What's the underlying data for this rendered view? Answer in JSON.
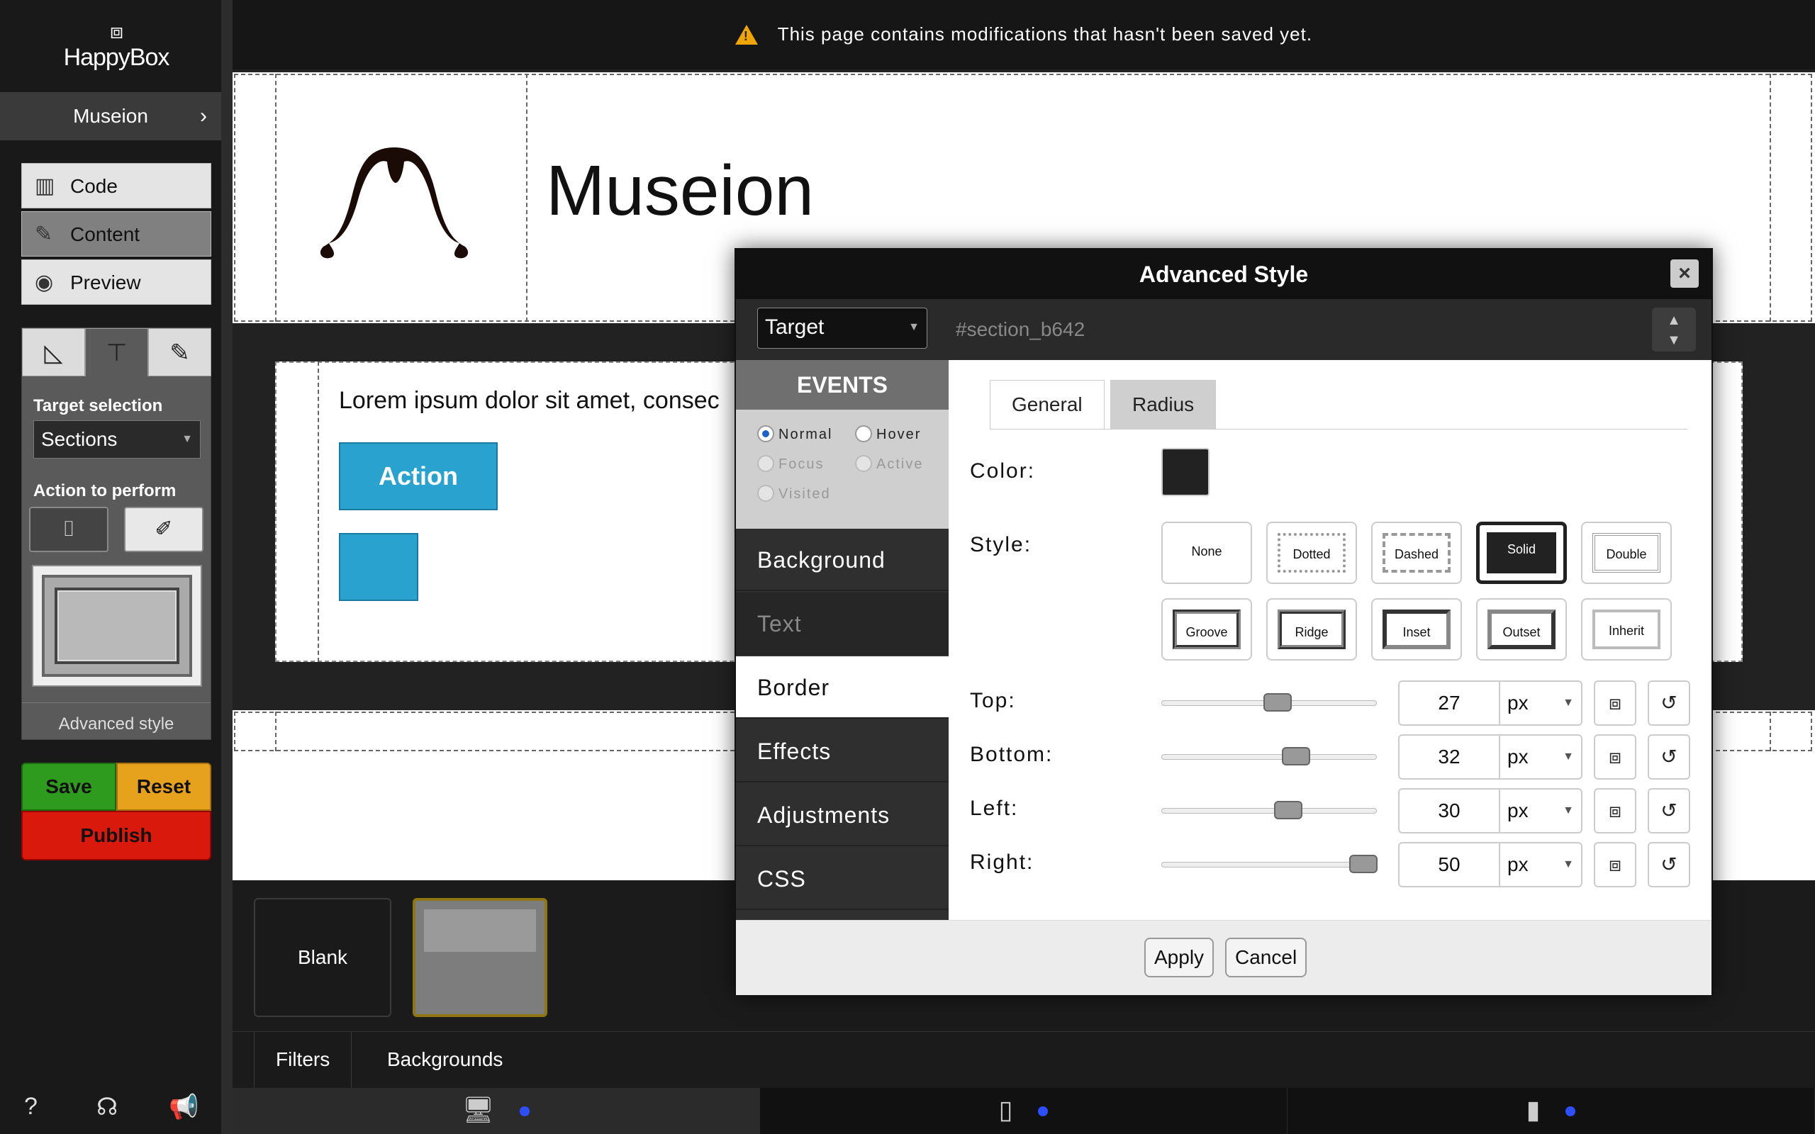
{
  "app": {
    "logo": "HappyBox",
    "site_name": "Museion"
  },
  "sidebar": {
    "modes": [
      {
        "label": "Code",
        "icon": "code-icon"
      },
      {
        "label": "Content",
        "icon": "edit-icon"
      },
      {
        "label": "Preview",
        "icon": "eye-icon"
      }
    ],
    "tool_tabs": [
      "ruler-icon",
      "paint-roller-icon",
      "pencil-icon"
    ],
    "target_selection_label": "Target selection",
    "target_selection_value": "Sections",
    "action_label": "Action to perform",
    "actions": [
      "spray-icon",
      "brush-icon"
    ],
    "advanced_style": "Advanced style",
    "save": "Save",
    "reset": "Reset",
    "publish": "Publish",
    "footer_icons": [
      "help-icon",
      "support-icon",
      "megaphone-icon"
    ]
  },
  "warning": "This page contains modifications that hasn't been saved yet.",
  "canvas": {
    "header_title": "Museion",
    "lorem": "Lorem ipsum dolor sit amet, consec",
    "action_button": "Action"
  },
  "bottom": {
    "tile_blank": "Blank",
    "tabs": [
      "Filters",
      "Backgrounds"
    ],
    "devices": [
      "desktop-icon",
      "tablet-icon",
      "phone-icon"
    ]
  },
  "modal": {
    "title": "Advanced Style",
    "target": "Target",
    "selector": "#section_b642",
    "events_title": "EVENTS",
    "events": [
      {
        "label": "Normal",
        "selected": true,
        "disabled": false
      },
      {
        "label": "Hover",
        "selected": false,
        "disabled": false
      },
      {
        "label": "Focus",
        "selected": false,
        "disabled": true
      },
      {
        "label": "Active",
        "selected": false,
        "disabled": true
      },
      {
        "label": "Visited",
        "selected": false,
        "disabled": true
      }
    ],
    "categories": [
      "Background",
      "Text",
      "Border",
      "Effects",
      "Adjustments",
      "CSS"
    ],
    "active_category": "Border",
    "tabs": [
      "General",
      "Radius"
    ],
    "color_label": "Color:",
    "color_value": "#222222",
    "style_label": "Style:",
    "styles": [
      "None",
      "Dotted",
      "Dashed",
      "Solid",
      "Double",
      "Groove",
      "Ridge",
      "Inset",
      "Outset",
      "Inherit"
    ],
    "selected_style": "Solid",
    "sides": [
      {
        "label": "Top:",
        "value": "27",
        "unit": "px",
        "level": 0.54
      },
      {
        "label": "Bottom:",
        "value": "32",
        "unit": "px",
        "level": 0.64
      },
      {
        "label": "Left:",
        "value": "30",
        "unit": "px",
        "level": 0.6
      },
      {
        "label": "Right:",
        "value": "50",
        "unit": "px",
        "level": 1.0
      }
    ],
    "apply": "Apply",
    "cancel": "Cancel"
  }
}
